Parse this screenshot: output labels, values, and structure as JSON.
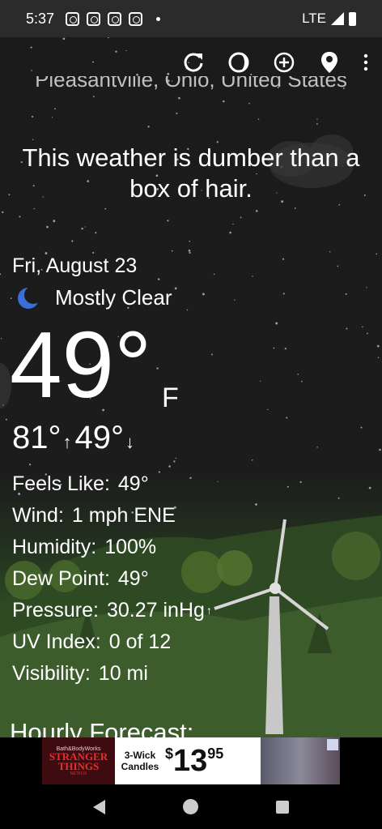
{
  "status_bar": {
    "time": "5:37",
    "network": "LTE",
    "notification_icons": [
      "instagram-icon",
      "instagram-icon",
      "instagram-icon",
      "instagram-icon"
    ]
  },
  "toolbar": {
    "icons": [
      "refresh-icon",
      "theme-icon",
      "add-location-icon",
      "location-pin-icon",
      "more-options-icon"
    ]
  },
  "weather": {
    "location": "Pleasantville, Ohio, United States",
    "quip": "This weather is dumber than a box of hair.",
    "date": "Fri, August 23",
    "condition": "Mostly Clear",
    "condition_icon": "moon-icon",
    "temperature": "49°",
    "unit": "F",
    "high": "81°",
    "low": "49°"
  },
  "details": {
    "feels_like_label": "Feels Like:",
    "feels_like_value": "49°",
    "wind_label": "Wind:",
    "wind_value": "1 mph ENE",
    "humidity_label": "Humidity:",
    "humidity_value": "100%",
    "dew_point_label": "Dew Point:",
    "dew_point_value": "49°",
    "pressure_label": "Pressure:",
    "pressure_value": "30.27 inHg",
    "uv_label": "UV Index:",
    "uv_value": "0 of 12",
    "visibility_label": "Visibility:",
    "visibility_value": "10 mi"
  },
  "hourly": {
    "title": "Hourly Forecast:"
  },
  "ad": {
    "brand": "Bath&BodyWorks",
    "title_line1": "STRANGER",
    "title_line2": "THINGS",
    "netflix": "NETFLIX",
    "product": "3-Wick Candles",
    "price_symbol": "$",
    "price_whole": "13",
    "price_cents": "95"
  },
  "colors": {
    "accent_moon": "#3a6fd8",
    "sky": "#1c1c1c",
    "grass": "#3f5f2b"
  }
}
